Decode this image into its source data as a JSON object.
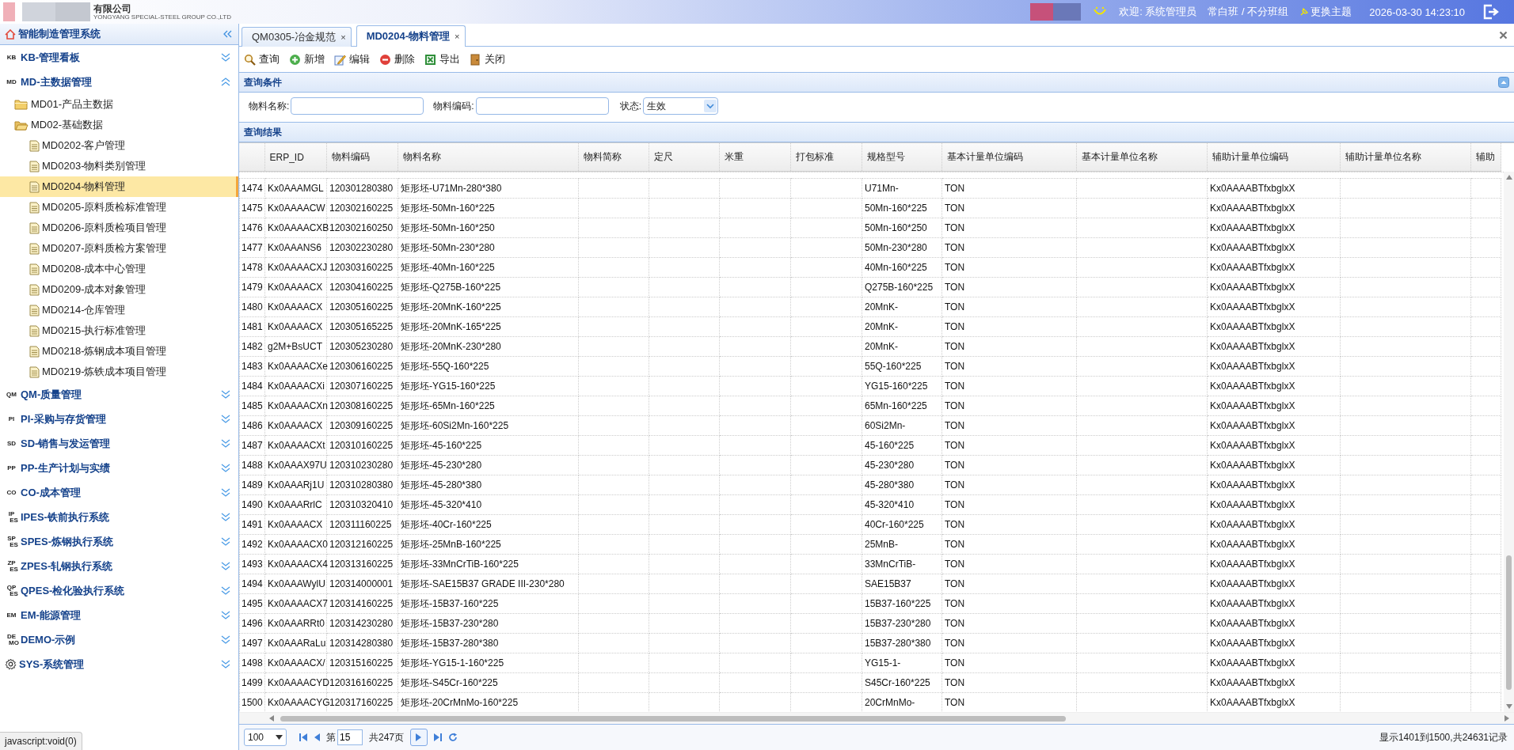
{
  "header": {
    "company_name": "有限公司",
    "company_en": "YONGYANG SPECIAL-STEEL GROUP CO.,LTD",
    "welcome": "欢迎: 系统管理员",
    "shift": "常白班 / 不分班组",
    "theme_link": "更换主题",
    "datetime": "2026-03-30 14:23:10"
  },
  "sidebar": {
    "title": "智能制造管理系统",
    "groups": [
      {
        "kind": "badge",
        "badge": [
          "KB"
        ],
        "label": "KB-管理看板",
        "expanded": false
      },
      {
        "kind": "badge",
        "badge": [
          "MD"
        ],
        "label": "MD-主数据管理",
        "expanded": true,
        "children": [
          {
            "kind": "folder",
            "label": "MD01-产品主数据",
            "expanded": false
          },
          {
            "kind": "folder",
            "label": "MD02-基础数据",
            "expanded": true,
            "children": [
              {
                "kind": "page",
                "label": "MD0202-客户管理",
                "selected": false
              },
              {
                "kind": "page",
                "label": "MD0203-物料类别管理",
                "selected": false
              },
              {
                "kind": "page",
                "label": "MD0204-物料管理",
                "selected": true
              },
              {
                "kind": "page",
                "label": "MD0205-原料质检标准管理",
                "selected": false
              },
              {
                "kind": "page",
                "label": "MD0206-原料质检项目管理",
                "selected": false
              },
              {
                "kind": "page",
                "label": "MD0207-原料质检方案管理",
                "selected": false
              },
              {
                "kind": "page",
                "label": "MD0208-成本中心管理",
                "selected": false
              },
              {
                "kind": "page",
                "label": "MD0209-成本对象管理",
                "selected": false
              },
              {
                "kind": "page",
                "label": "MD0214-仓库管理",
                "selected": false
              },
              {
                "kind": "page",
                "label": "MD0215-执行标准管理",
                "selected": false
              },
              {
                "kind": "page",
                "label": "MD0218-炼钢成本项目管理",
                "selected": false
              },
              {
                "kind": "page",
                "label": "MD0219-炼铁成本项目管理",
                "selected": false
              }
            ]
          }
        ]
      },
      {
        "kind": "badge",
        "badge": [
          "QM"
        ],
        "label": "QM-质量管理",
        "expanded": false
      },
      {
        "kind": "badge",
        "badge": [
          "PI"
        ],
        "label": "PI-采购与存货管理",
        "expanded": false
      },
      {
        "kind": "badge",
        "badge": [
          "SD"
        ],
        "label": "SD-销售与发运管理",
        "expanded": false
      },
      {
        "kind": "badge",
        "badge": [
          "PP"
        ],
        "label": "PP-生产计划与实绩",
        "expanded": false
      },
      {
        "kind": "badge",
        "badge": [
          "CO"
        ],
        "label": "CO-成本管理",
        "expanded": false
      },
      {
        "kind": "badge",
        "badge": [
          "IP",
          "ES"
        ],
        "label": "IPES-铁前执行系统",
        "expanded": false
      },
      {
        "kind": "badge",
        "badge": [
          "SP",
          "ES"
        ],
        "label": "SPES-炼钢执行系统",
        "expanded": false
      },
      {
        "kind": "badge",
        "badge": [
          "ZP",
          "ES"
        ],
        "label": "ZPES-轧钢执行系统",
        "expanded": false
      },
      {
        "kind": "badge",
        "badge": [
          "QP",
          "ES"
        ],
        "label": "QPES-检化验执行系统",
        "expanded": false
      },
      {
        "kind": "badge",
        "badge": [
          "EM"
        ],
        "label": "EM-能源管理",
        "expanded": false
      },
      {
        "kind": "badge",
        "badge": [
          "DE",
          "MO"
        ],
        "label": "DEMO-示例",
        "expanded": false
      },
      {
        "kind": "gear",
        "label": "SYS-系统管理",
        "expanded": false
      }
    ]
  },
  "tabs": [
    {
      "label": "QM0305-冶金规范",
      "close": "×",
      "selected": false
    },
    {
      "label": "MD0204-物料管理",
      "close": "×",
      "selected": true
    }
  ],
  "toolbar": [
    {
      "kind": "search",
      "label": "查询"
    },
    {
      "kind": "add",
      "label": "新增"
    },
    {
      "kind": "edit",
      "label": "编辑"
    },
    {
      "kind": "delete",
      "label": "删除"
    },
    {
      "kind": "export",
      "label": "导出"
    },
    {
      "kind": "close",
      "label": "关闭"
    }
  ],
  "query_panel": {
    "title": "查询条件",
    "fields": [
      {
        "kind": "text",
        "label": "物料名称:"
      },
      {
        "kind": "text",
        "label": "物料编码:"
      },
      {
        "kind": "select",
        "label": "状态:",
        "value": "生效"
      }
    ]
  },
  "results": {
    "title": "查询结果",
    "columns": [
      "ERP_ID",
      "物料编码",
      "物料名称",
      "物料简称",
      "定尺",
      "米重",
      "打包标准",
      "规格型号",
      "基本计量单位编码",
      "基本计量单位名称",
      "辅助计量单位编码",
      "辅助计量单位名称",
      "辅助"
    ],
    "rows": [
      {
        "number": "1474",
        "cells": [
          "Kx0AAAMGL",
          "120301280380",
          "矩形坯-U71Mn-280*380",
          null,
          null,
          null,
          null,
          "U71Mn-",
          "TON",
          null,
          "Kx0AAAABTfxbglxX",
          null,
          null
        ]
      },
      {
        "number": "1475",
        "cells": [
          "Kx0AAAACW",
          "120302160225",
          "矩形坯-50Mn-160*225",
          null,
          null,
          null,
          null,
          "50Mn-160*225",
          "TON",
          null,
          "Kx0AAAABTfxbglxX",
          null,
          null
        ]
      },
      {
        "number": "1476",
        "cells": [
          "Kx0AAAACXB",
          "120302160250",
          "矩形坯-50Mn-160*250",
          null,
          null,
          null,
          null,
          "50Mn-160*250",
          "TON",
          null,
          "Kx0AAAABTfxbglxX",
          null,
          null
        ]
      },
      {
        "number": "1477",
        "cells": [
          "Kx0AAANS6",
          "120302230280",
          "矩形坯-50Mn-230*280",
          null,
          null,
          null,
          null,
          "50Mn-230*280",
          "TON",
          null,
          "Kx0AAAABTfxbglxX",
          null,
          null
        ]
      },
      {
        "number": "1478",
        "cells": [
          "Kx0AAAACXJ",
          "120303160225",
          "矩形坯-40Mn-160*225",
          null,
          null,
          null,
          null,
          "40Mn-160*225",
          "TON",
          null,
          "Kx0AAAABTfxbglxX",
          null,
          null
        ]
      },
      {
        "number": "1479",
        "cells": [
          "Kx0AAAACX",
          "120304160225",
          "矩形坯-Q275B-160*225",
          null,
          null,
          null,
          null,
          "Q275B-160*225",
          "TON",
          null,
          "Kx0AAAABTfxbglxX",
          null,
          null
        ]
      },
      {
        "number": "1480",
        "cells": [
          "Kx0AAAACX",
          "120305160225",
          "矩形坯-20MnK-160*225",
          null,
          null,
          null,
          null,
          "20MnK-",
          "TON",
          null,
          "Kx0AAAABTfxbglxX",
          null,
          null
        ]
      },
      {
        "number": "1481",
        "cells": [
          "Kx0AAAACX",
          "120305165225",
          "矩形坯-20MnK-165*225",
          null,
          null,
          null,
          null,
          "20MnK-",
          "TON",
          null,
          "Kx0AAAABTfxbglxX",
          null,
          null
        ]
      },
      {
        "number": "1482",
        "cells": [
          "g2M+BsUCT",
          "120305230280",
          "矩形坯-20MnK-230*280",
          null,
          null,
          null,
          null,
          "20MnK-",
          "TON",
          null,
          "Kx0AAAABTfxbglxX",
          null,
          null
        ]
      },
      {
        "number": "1483",
        "cells": [
          "Kx0AAAACXe",
          "120306160225",
          "矩形坯-55Q-160*225",
          null,
          null,
          null,
          null,
          "55Q-160*225",
          "TON",
          null,
          "Kx0AAAABTfxbglxX",
          null,
          null
        ]
      },
      {
        "number": "1484",
        "cells": [
          "Kx0AAAACXi",
          "120307160225",
          "矩形坯-YG15-160*225",
          null,
          null,
          null,
          null,
          "YG15-160*225",
          "TON",
          null,
          "Kx0AAAABTfxbglxX",
          null,
          null
        ]
      },
      {
        "number": "1485",
        "cells": [
          "Kx0AAAACXn",
          "120308160225",
          "矩形坯-65Mn-160*225",
          null,
          null,
          null,
          null,
          "65Mn-160*225",
          "TON",
          null,
          "Kx0AAAABTfxbglxX",
          null,
          null
        ]
      },
      {
        "number": "1486",
        "cells": [
          "Kx0AAAACX",
          "120309160225",
          "矩形坯-60Si2Mn-160*225",
          null,
          null,
          null,
          null,
          "60Si2Mn-",
          "TON",
          null,
          "Kx0AAAABTfxbglxX",
          null,
          null
        ]
      },
      {
        "number": "1487",
        "cells": [
          "Kx0AAAACXt",
          "120310160225",
          "矩形坯-45-160*225",
          null,
          null,
          null,
          null,
          "45-160*225",
          "TON",
          null,
          "Kx0AAAABTfxbglxX",
          null,
          null
        ]
      },
      {
        "number": "1488",
        "cells": [
          "Kx0AAAX97U",
          "120310230280",
          "矩形坯-45-230*280",
          null,
          null,
          null,
          null,
          "45-230*280",
          "TON",
          null,
          "Kx0AAAABTfxbglxX",
          null,
          null
        ]
      },
      {
        "number": "1489",
        "cells": [
          "Kx0AAARj1U",
          "120310280380",
          "矩形坯-45-280*380",
          null,
          null,
          null,
          null,
          "45-280*380",
          "TON",
          null,
          "Kx0AAAABTfxbglxX",
          null,
          null
        ]
      },
      {
        "number": "1490",
        "cells": [
          "Kx0AAARrlC",
          "120310320410",
          "矩形坯-45-320*410",
          null,
          null,
          null,
          null,
          "45-320*410",
          "TON",
          null,
          "Kx0AAAABTfxbglxX",
          null,
          null
        ]
      },
      {
        "number": "1491",
        "cells": [
          "Kx0AAAACX",
          "120311160225",
          "矩形坯-40Cr-160*225",
          null,
          null,
          null,
          null,
          "40Cr-160*225",
          "TON",
          null,
          "Kx0AAAABTfxbglxX",
          null,
          null
        ]
      },
      {
        "number": "1492",
        "cells": [
          "Kx0AAAACX0",
          "120312160225",
          "矩形坯-25MnB-160*225",
          null,
          null,
          null,
          null,
          "25MnB-",
          "TON",
          null,
          "Kx0AAAABTfxbglxX",
          null,
          null
        ]
      },
      {
        "number": "1493",
        "cells": [
          "Kx0AAAACX4",
          "120313160225",
          "矩形坯-33MnCrTiB-160*225",
          null,
          null,
          null,
          null,
          "33MnCrTiB-",
          "TON",
          null,
          "Kx0AAAABTfxbglxX",
          null,
          null
        ]
      },
      {
        "number": "1494",
        "cells": [
          "Kx0AAAWylU",
          "120314000001",
          "矩形坯-SAE15B37 GRADE III-230*280",
          null,
          null,
          null,
          null,
          "SAE15B37",
          "TON",
          null,
          "Kx0AAAABTfxbglxX",
          null,
          null
        ]
      },
      {
        "number": "1495",
        "cells": [
          "Kx0AAAACX7",
          "120314160225",
          "矩形坯-15B37-160*225",
          null,
          null,
          null,
          null,
          "15B37-160*225",
          "TON",
          null,
          "Kx0AAAABTfxbglxX",
          null,
          null
        ]
      },
      {
        "number": "1496",
        "cells": [
          "Kx0AAARRt0",
          "120314230280",
          "矩形坯-15B37-230*280",
          null,
          null,
          null,
          null,
          "15B37-230*280",
          "TON",
          null,
          "Kx0AAAABTfxbglxX",
          null,
          null
        ]
      },
      {
        "number": "1497",
        "cells": [
          "Kx0AAARaLu",
          "120314280380",
          "矩形坯-15B37-280*380",
          null,
          null,
          null,
          null,
          "15B37-280*380",
          "TON",
          null,
          "Kx0AAAABTfxbglxX",
          null,
          null
        ]
      },
      {
        "number": "1498",
        "cells": [
          "Kx0AAAACX/",
          "120315160225",
          "矩形坯-YG15-1-160*225",
          null,
          null,
          null,
          null,
          "YG15-1-",
          "TON",
          null,
          "Kx0AAAABTfxbglxX",
          null,
          null
        ]
      },
      {
        "number": "1499",
        "cells": [
          "Kx0AAAACYD",
          "120316160225",
          "矩形坯-S45Cr-160*225",
          null,
          null,
          null,
          null,
          "S45Cr-160*225",
          "TON",
          null,
          "Kx0AAAABTfxbglxX",
          null,
          null
        ]
      },
      {
        "number": "1500",
        "cells": [
          "Kx0AAAACYG",
          "120317160225",
          "矩形坯-20CrMnMo-160*225",
          null,
          null,
          null,
          null,
          "20CrMnMo-",
          "TON",
          null,
          "Kx0AAAABTfxbglxX",
          null,
          null
        ]
      }
    ]
  },
  "pager": {
    "page_size": "100",
    "page_prefix": "第",
    "page": "15",
    "page_total": "共247页",
    "summary": "显示1401到1500,共24631记录"
  },
  "browser_status": "javascript:void(0)"
}
